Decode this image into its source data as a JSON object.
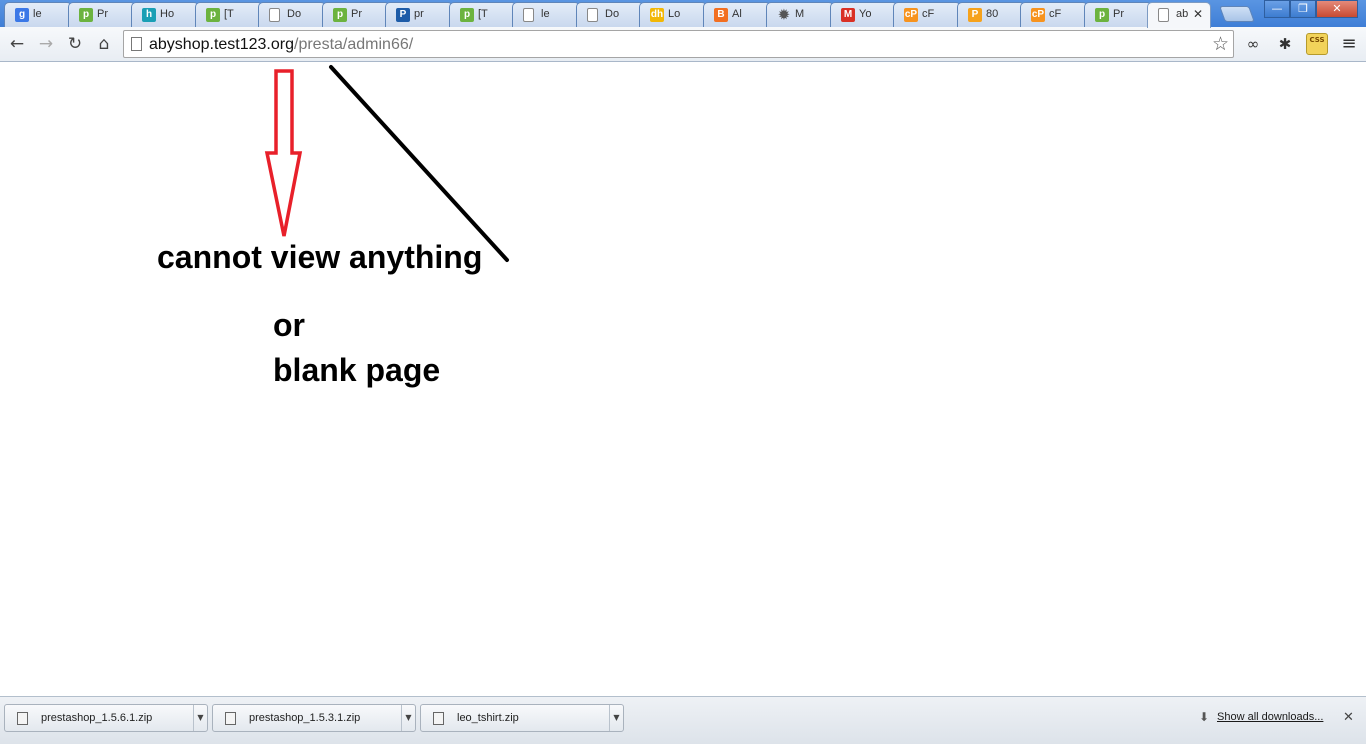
{
  "browser": {
    "tabs": [
      {
        "label": "le",
        "icon": "google-icon",
        "color": "#3b78e7",
        "glyph": "g"
      },
      {
        "label": "Pr",
        "icon": "prestashop-icon",
        "color": "#6cb33f",
        "glyph": "p"
      },
      {
        "label": "Ho",
        "icon": "hostgator-icon",
        "color": "#1a9fb5",
        "glyph": "h"
      },
      {
        "label": "[T",
        "icon": "prestashop-icon",
        "color": "#6cb33f",
        "glyph": "p"
      },
      {
        "label": "Do",
        "icon": "page-icon",
        "color": "#e8e8e8",
        "glyph": ""
      },
      {
        "label": "Pr",
        "icon": "prestashop-icon",
        "color": "#6cb33f",
        "glyph": "p"
      },
      {
        "label": "pr",
        "icon": "prestashop-forum-icon",
        "color": "#1e5ca8",
        "glyph": "P"
      },
      {
        "label": "[T",
        "icon": "prestashop-icon",
        "color": "#6cb33f",
        "glyph": "p"
      },
      {
        "label": "le",
        "icon": "page-icon",
        "color": "#e8e8e8",
        "glyph": ""
      },
      {
        "label": "Do",
        "icon": "page-icon",
        "color": "#e8e8e8",
        "glyph": ""
      },
      {
        "label": "Lo",
        "icon": "dh-icon",
        "color": "#f2b705",
        "glyph": "dh"
      },
      {
        "label": "Al",
        "icon": "blogger-icon",
        "color": "#f26f21",
        "glyph": "B"
      },
      {
        "label": "M",
        "icon": "gear-icon",
        "color": "#555555",
        "glyph": "✹"
      },
      {
        "label": "Yo",
        "icon": "gmail-icon",
        "color": "#d93025",
        "glyph": "M"
      },
      {
        "label": "cF",
        "icon": "cpanel-icon",
        "color": "#f7931e",
        "glyph": "cP"
      },
      {
        "label": "80",
        "icon": "phpmyadmin-icon",
        "color": "#f6a21c",
        "glyph": "P"
      },
      {
        "label": "cF",
        "icon": "cpanel-icon",
        "color": "#f7931e",
        "glyph": "cP"
      },
      {
        "label": "Pr",
        "icon": "prestashop-icon",
        "color": "#6cb33f",
        "glyph": "p"
      },
      {
        "label": "ab",
        "icon": "page-icon",
        "color": "#e8e8e8",
        "glyph": "",
        "active": true
      }
    ],
    "tab_close_glyph": "✕",
    "window_controls": {
      "minimize": "—",
      "maximize": "❐",
      "close": "✕"
    }
  },
  "toolbar": {
    "back": "←",
    "forward": "→",
    "reload": "↻",
    "home": "⌂",
    "url_host": "abyshop.test123.org",
    "url_path": "/presta/admin66/",
    "star": "☆",
    "extensions": [
      {
        "name": "infinity-ext-icon",
        "glyph": "∞"
      },
      {
        "name": "firebug-ext-icon",
        "glyph": "✱"
      },
      {
        "name": "css-ext-icon",
        "glyph": "CSS"
      },
      {
        "name": "wrench-menu-icon",
        "glyph": "≡"
      }
    ]
  },
  "annotations": {
    "line1": "cannot view anything",
    "line2": "or",
    "line3": "blank page",
    "arrow_color": "#e8202a",
    "line_color": "#000000"
  },
  "downloads": {
    "items": [
      {
        "filename": "prestashop_1.5.6.1.zip"
      },
      {
        "filename": "prestashop_1.5.3.1.zip"
      },
      {
        "filename": "leo_tshirt.zip"
      }
    ],
    "show_all": "Show all downloads...",
    "close": "✕"
  }
}
